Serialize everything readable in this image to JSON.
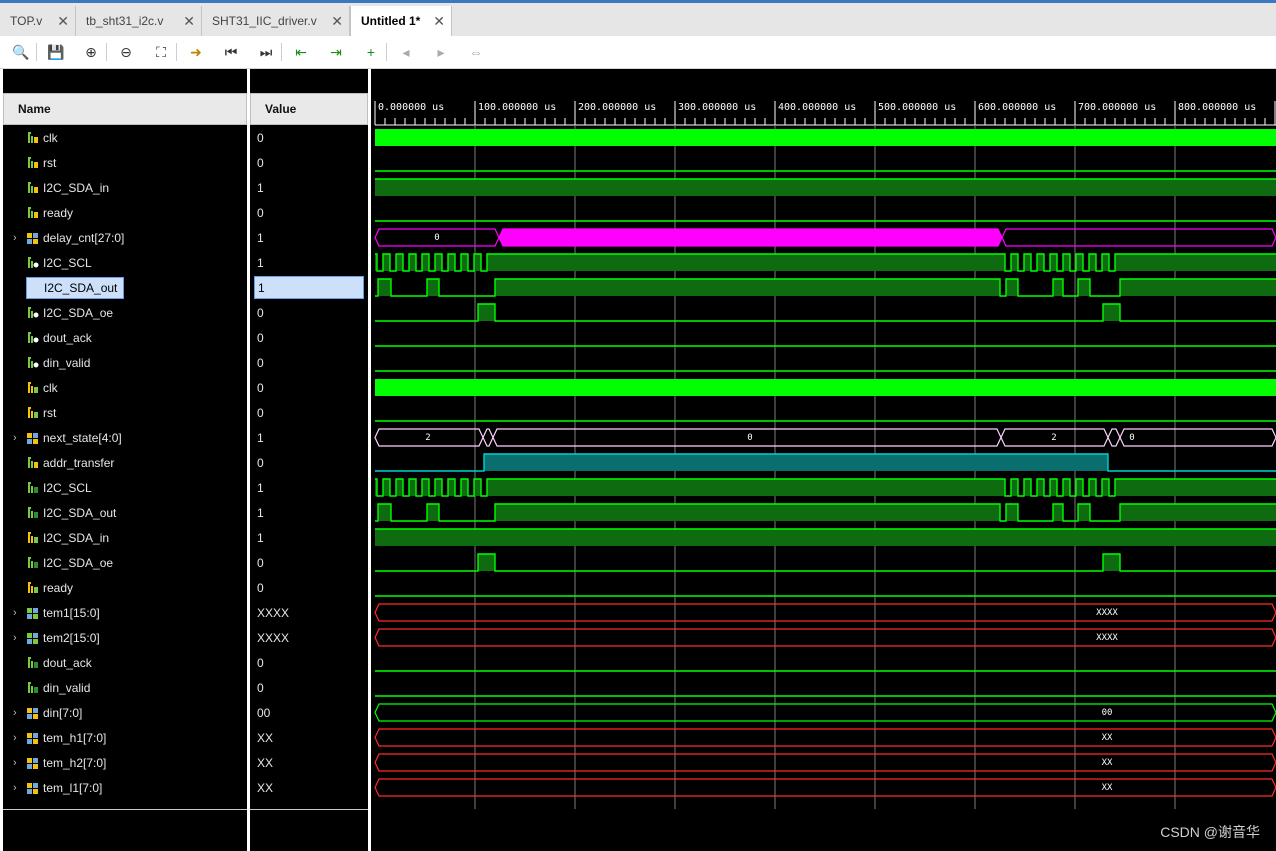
{
  "tabs": [
    {
      "label": "TOP.v",
      "active": false
    },
    {
      "label": "tb_sht31_i2c.v",
      "active": false
    },
    {
      "label": "SHT31_IIC_driver.v",
      "active": false
    },
    {
      "label": "Untitled 1*",
      "active": true
    }
  ],
  "toolbar": [
    {
      "name": "search-icon",
      "glyph": "🔍"
    },
    {
      "name": "save-icon",
      "glyph": "💾"
    },
    {
      "name": "zoom-in-icon",
      "glyph": "⊕"
    },
    {
      "name": "zoom-out-icon",
      "glyph": "⊖"
    },
    {
      "name": "zoom-fit-icon",
      "glyph": "⛶"
    },
    {
      "name": "go-to-cursor-icon",
      "glyph": "➜"
    },
    {
      "name": "go-to-time-zero-icon",
      "glyph": "⏮"
    },
    {
      "name": "go-to-last-time-icon",
      "glyph": "⏭"
    },
    {
      "name": "previous-transition-icon",
      "glyph": "⇤"
    },
    {
      "name": "next-transition-icon",
      "glyph": "⇥"
    },
    {
      "name": "add-marker-icon",
      "glyph": "+"
    },
    {
      "name": "previous-marker-icon",
      "glyph": "◂"
    },
    {
      "name": "next-marker-icon",
      "glyph": "▸"
    },
    {
      "name": "swap-cursors-icon",
      "glyph": "⇔"
    }
  ],
  "headers": {
    "name": "Name",
    "value": "Value"
  },
  "timeline": {
    "unit": "us",
    "ticks": [
      "0.000000 us",
      "100.000000 us",
      "200.000000 us",
      "300.000000 us",
      "400.000000 us",
      "500.000000 us",
      "600.000000 us",
      "700.000000 us",
      "800.000000 us"
    ]
  },
  "colors": {
    "wave_green": "#00ff00",
    "bus_magenta": "#ff00ff",
    "bus_cyan": "#00d2d2",
    "bus_red": "#ff2b2b",
    "grid": "#7d7d7d"
  },
  "signals": [
    {
      "name": "clk",
      "value": "0",
      "icon": "in",
      "bus": false
    },
    {
      "name": "rst",
      "value": "0",
      "icon": "in",
      "bus": false
    },
    {
      "name": "I2C_SDA_in",
      "value": "1",
      "icon": "in",
      "bus": false
    },
    {
      "name": "ready",
      "value": "0",
      "icon": "in",
      "bus": false
    },
    {
      "name": "delay_cnt[27:0]",
      "value": "1",
      "icon": "bus",
      "bus": true
    },
    {
      "name": "I2C_SCL",
      "value": "1",
      "icon": "out",
      "bus": false
    },
    {
      "name": "I2C_SDA_out",
      "value": "1",
      "icon": "out",
      "bus": false,
      "selected": true
    },
    {
      "name": "I2C_SDA_oe",
      "value": "0",
      "icon": "out",
      "bus": false
    },
    {
      "name": "dout_ack",
      "value": "0",
      "icon": "out",
      "bus": false
    },
    {
      "name": "din_valid",
      "value": "0",
      "icon": "out",
      "bus": false
    },
    {
      "name": "clk",
      "value": "0",
      "icon": "in2",
      "bus": false
    },
    {
      "name": "rst",
      "value": "0",
      "icon": "in2",
      "bus": false
    },
    {
      "name": "next_state[4:0]",
      "value": "1",
      "icon": "bus",
      "bus": true
    },
    {
      "name": "addr_transfer",
      "value": "0",
      "icon": "in",
      "bus": false
    },
    {
      "name": "I2C_SCL",
      "value": "1",
      "icon": "out2",
      "bus": false
    },
    {
      "name": "I2C_SDA_out",
      "value": "1",
      "icon": "out2",
      "bus": false
    },
    {
      "name": "I2C_SDA_in",
      "value": "1",
      "icon": "in2",
      "bus": false
    },
    {
      "name": "I2C_SDA_oe",
      "value": "0",
      "icon": "out2",
      "bus": false
    },
    {
      "name": "ready",
      "value": "0",
      "icon": "in2",
      "bus": false
    },
    {
      "name": "tem1[15:0]",
      "value": "XXXX",
      "icon": "bus2",
      "bus": true
    },
    {
      "name": "tem2[15:0]",
      "value": "XXXX",
      "icon": "bus2",
      "bus": true
    },
    {
      "name": "dout_ack",
      "value": "0",
      "icon": "out2",
      "bus": false
    },
    {
      "name": "din_valid",
      "value": "0",
      "icon": "out2",
      "bus": false
    },
    {
      "name": "din[7:0]",
      "value": "00",
      "icon": "bus",
      "bus": true
    },
    {
      "name": "tem_h1[7:0]",
      "value": "XX",
      "icon": "bus",
      "bus": true
    },
    {
      "name": "tem_h2[7:0]",
      "value": "XX",
      "icon": "bus",
      "bus": true
    },
    {
      "name": "tem_l1[7:0]",
      "value": "XX",
      "icon": "bus",
      "bus": true
    }
  ],
  "bus_labels": {
    "delay_cnt": [
      "0"
    ],
    "next_state": [
      "2",
      "0",
      "2",
      "0"
    ],
    "tem1": "XXXX",
    "tem2": "XXXX",
    "din": "00",
    "tem_h1": "XX",
    "tem_h2": "XX",
    "tem_l1": "XX"
  },
  "watermark": "CSDN @谢音华"
}
